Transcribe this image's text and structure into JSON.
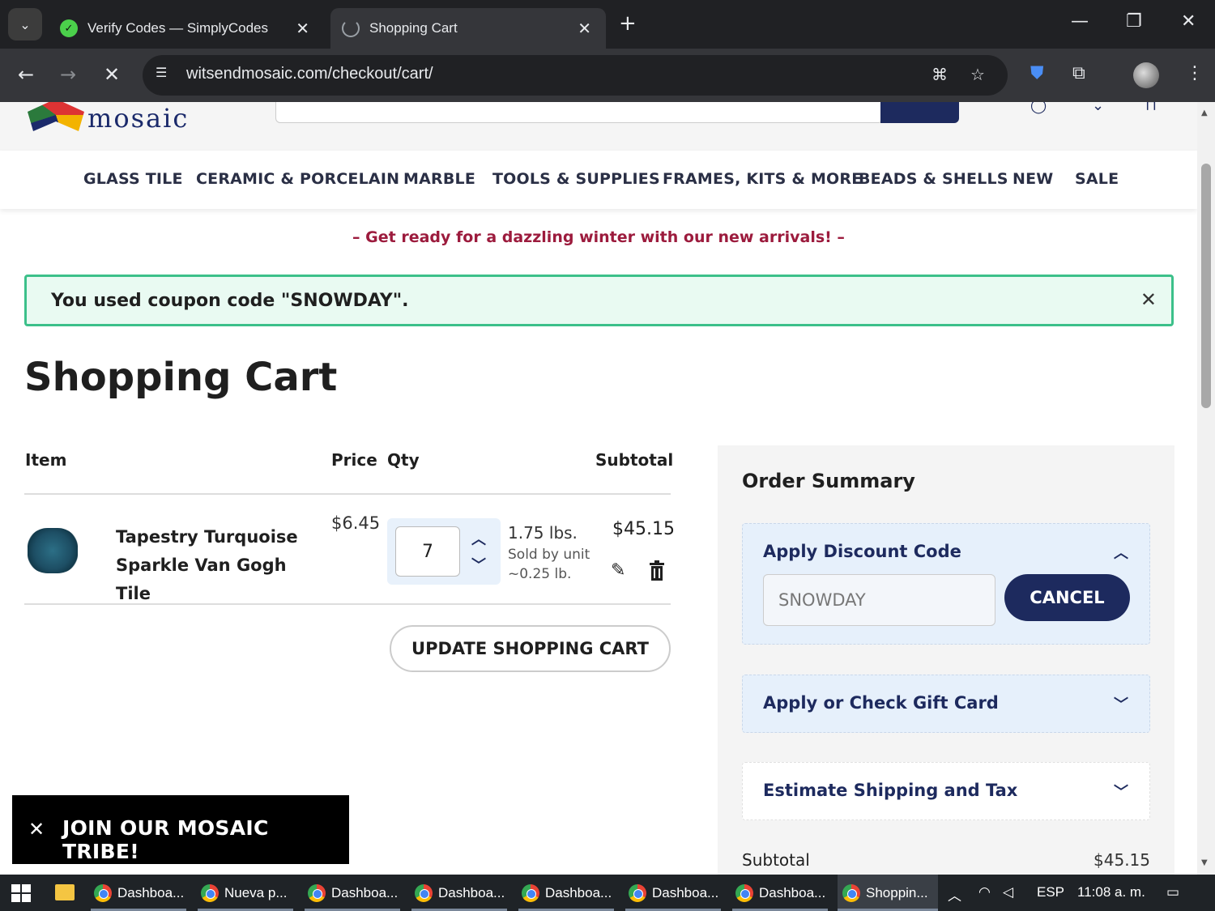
{
  "browser": {
    "tabs": [
      {
        "title": "Verify Codes — SimplyCodes",
        "active": false
      },
      {
        "title": "Shopping Cart",
        "active": true
      }
    ],
    "url": "witsendmosaic.com/checkout/cart/"
  },
  "site": {
    "logo_text": "mosaic",
    "nav": [
      "GLASS TILE",
      "CERAMIC & PORCELAIN",
      "MARBLE",
      "TOOLS & SUPPLIES",
      "FRAMES, KITS & MORE",
      "BEADS & SHELLS",
      "NEW",
      "SALE"
    ],
    "promo": "– Get ready for a dazzling winter with our new arrivals! –"
  },
  "message": {
    "text": "You used coupon code \"SNOWDAY\"."
  },
  "cart": {
    "title": "Shopping Cart",
    "headers": {
      "item": "Item",
      "price": "Price",
      "qty": "Qty",
      "subtotal": "Subtotal"
    },
    "item": {
      "name": "Tapestry Turquoise Sparkle Van Gogh Tile",
      "price": "$6.45",
      "qty": "7",
      "unit_main": "1.75 lbs.",
      "unit_sub1": "Sold by unit",
      "unit_sub2": "~0.25 lb.",
      "subtotal": "$45.15"
    },
    "update_label": "UPDATE SHOPPING CART"
  },
  "summary": {
    "title": "Order Summary",
    "discount": {
      "title": "Apply Discount Code",
      "value": "SNOWDAY",
      "cancel_label": "CANCEL"
    },
    "gift": {
      "title": "Apply or Check Gift Card"
    },
    "shipping": {
      "title": "Estimate Shipping and Tax"
    },
    "subtotal_label": "Subtotal",
    "subtotal_value": "$45.15"
  },
  "popup": {
    "text": "JOIN OUR MOSAIC TRIBE!"
  },
  "taskbar": {
    "items": [
      "Dashboa...",
      "Nueva p...",
      "Dashboa...",
      "Dashboa...",
      "Dashboa...",
      "Dashboa...",
      "Dashboa...",
      "Shoppin..."
    ],
    "lang": "ESP",
    "time": "11:08 a. m."
  },
  "colors": {
    "brand_navy": "#1d2a5e",
    "promo_red": "#9c1b3d",
    "success_green": "#3cc08a"
  }
}
